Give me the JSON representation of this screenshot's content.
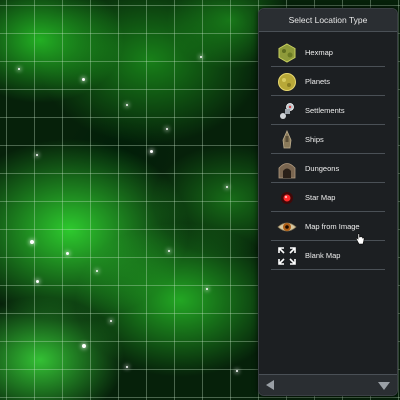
{
  "panel": {
    "title": "Select Location Type",
    "items": [
      {
        "label": "Hexmap",
        "icon": "hexmap-icon"
      },
      {
        "label": "Planets",
        "icon": "planet-icon"
      },
      {
        "label": "Settlements",
        "icon": "settlement-icon"
      },
      {
        "label": "Ships",
        "icon": "ship-icon"
      },
      {
        "label": "Dungeons",
        "icon": "dungeon-icon"
      },
      {
        "label": "Star Map",
        "icon": "star-map-icon"
      },
      {
        "label": "Map from Image",
        "icon": "eye-icon"
      },
      {
        "label": "Blank Map",
        "icon": "expand-icon"
      }
    ]
  },
  "colors": {
    "panel_bg": "#1c1f22",
    "header_bg": "#2a2e32",
    "nebula": "#32c832",
    "text": "#f0f0f0"
  }
}
